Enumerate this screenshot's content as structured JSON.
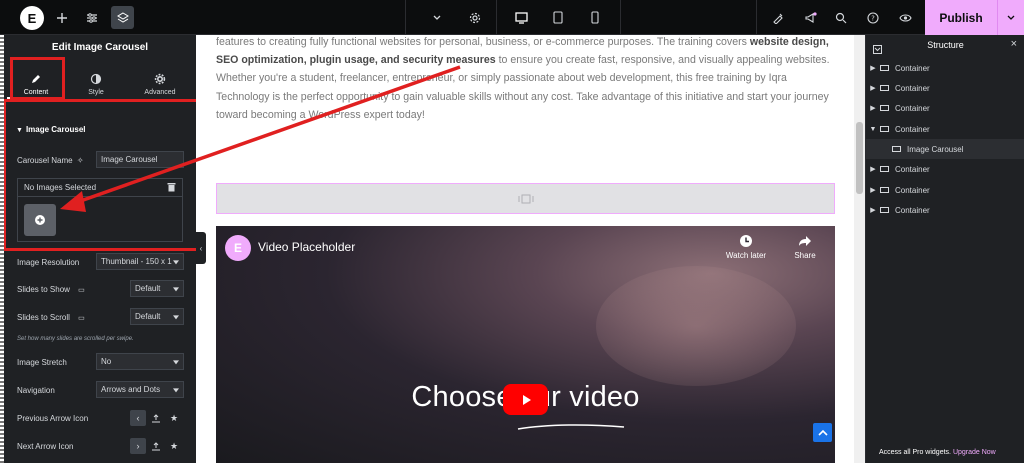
{
  "topbar": {
    "logo": "E",
    "device_icons": [
      "desktop-icon",
      "tablet-icon",
      "mobile-icon"
    ],
    "publish_label": "Publish"
  },
  "panel": {
    "title": "Edit Image Carousel",
    "tabs": [
      {
        "label": "Content",
        "icon": "pencil-icon"
      },
      {
        "label": "Style",
        "icon": "half-circle-icon"
      },
      {
        "label": "Advanced",
        "icon": "gear-icon"
      }
    ],
    "section_title": "Image Carousel",
    "carousel_name_label": "Carousel Name",
    "carousel_name_value": "Image Carousel",
    "gallery_header": "No Images Selected",
    "fields": [
      {
        "label": "Image Resolution",
        "value": "Thumbnail - 150 x 1"
      },
      {
        "label": "Slides to Show",
        "value": "Default"
      },
      {
        "label": "Slides to Scroll",
        "value": "Default"
      },
      {
        "label": "Image Stretch",
        "value": "No"
      },
      {
        "label": "Navigation",
        "value": "Arrows and Dots"
      },
      {
        "label": "Previous Arrow Icon",
        "value": ""
      },
      {
        "label": "Next Arrow Icon",
        "value": ""
      }
    ],
    "scroll_hint": "Set how many slides are scrolled per swipe."
  },
  "canvas": {
    "para_1": "features to creating fully functional websites for personal, business, or e-commerce purposes. The training covers ",
    "para_bold_1": "website design, SEO optimization, plugin usage, and security measures",
    "para_2": " to ensure you create fast, responsive, and visually appealing websites. Whether you're a student, freelancer, entrepreneur, or simply passionate about web development, this free training by Iqra Technology is the perfect opportunity to gain valuable skills without any cost. Take advantage of this initiative and start your journey toward becoming a WordPress expert today!",
    "video": {
      "logo": "E",
      "title": "Video Placeholder",
      "watch_later": "Watch later",
      "share": "Share",
      "big_text_a": "Choose ",
      "big_text_b": "ur",
      "big_text_c": " video"
    }
  },
  "structure": {
    "title": "Structure",
    "items": [
      {
        "label": "Container",
        "level": 0,
        "expanded": false
      },
      {
        "label": "Container",
        "level": 0,
        "expanded": false
      },
      {
        "label": "Container",
        "level": 0,
        "expanded": false
      },
      {
        "label": "Container",
        "level": 0,
        "expanded": true
      },
      {
        "label": "Image Carousel",
        "level": 1,
        "expanded": false
      },
      {
        "label": "Container",
        "level": 0,
        "expanded": false
      },
      {
        "label": "Container",
        "level": 0,
        "expanded": false
      },
      {
        "label": "Container",
        "level": 0,
        "expanded": false
      }
    ],
    "footer_text": "Access all Pro widgets.",
    "footer_link": "Upgrade Now"
  },
  "colors": {
    "accent": "#f0abfc",
    "annotation_red": "#e02020",
    "panel_bg": "#1f2124",
    "youtube_red": "#ff0000"
  }
}
